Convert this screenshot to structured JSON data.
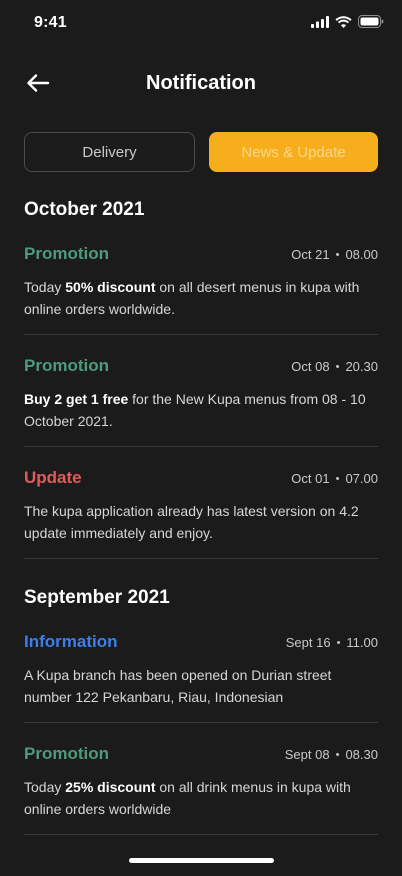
{
  "status_bar": {
    "time": "9:41"
  },
  "header": {
    "title": "Notification"
  },
  "tabs": [
    {
      "label": "Delivery",
      "active": false
    },
    {
      "label": "News & Update",
      "active": true
    }
  ],
  "sections": [
    {
      "title": "October 2021",
      "items": [
        {
          "category": "Promotion",
          "date": "Oct 21",
          "time": "08.00",
          "body_pre": "Today ",
          "body_bold": "50% discount",
          "body_post": " on all desert menus in kupa with online orders worldwide."
        },
        {
          "category": "Promotion",
          "date": "Oct 08",
          "time": "20.30",
          "body_pre": "",
          "body_bold": "Buy 2 get 1 free",
          "body_post": " for the New Kupa menus from 08 - 10 October 2021."
        },
        {
          "category": "Update",
          "date": "Oct 01",
          "time": "07.00",
          "body_pre": "The kupa application already has latest version on 4.2 update immediately and enjoy.",
          "body_bold": "",
          "body_post": ""
        }
      ]
    },
    {
      "title": "September 2021",
      "items": [
        {
          "category": "Information",
          "date": "Sept 16",
          "time": "11.00",
          "body_pre": "A Kupa branch has been opened on Durian street number 122 Pekanbaru, Riau, Indonesian",
          "body_bold": "",
          "body_post": ""
        },
        {
          "category": "Promotion",
          "date": "Sept 08",
          "time": "08.30",
          "body_pre": "Today ",
          "body_bold": "25% discount",
          "body_post": " on all drink menus in kupa with online orders worldwide"
        }
      ]
    }
  ],
  "meta_separator": "•",
  "colors": {
    "background": "#1b1b1b",
    "accent": "#f7ae1c",
    "promotion": "#4e9a7d",
    "update": "#e25b5b",
    "information": "#3d7fea"
  },
  "icons": {
    "back": "arrow-left-icon",
    "signal": "cellular-signal-icon",
    "wifi": "wifi-icon",
    "battery": "battery-icon"
  }
}
